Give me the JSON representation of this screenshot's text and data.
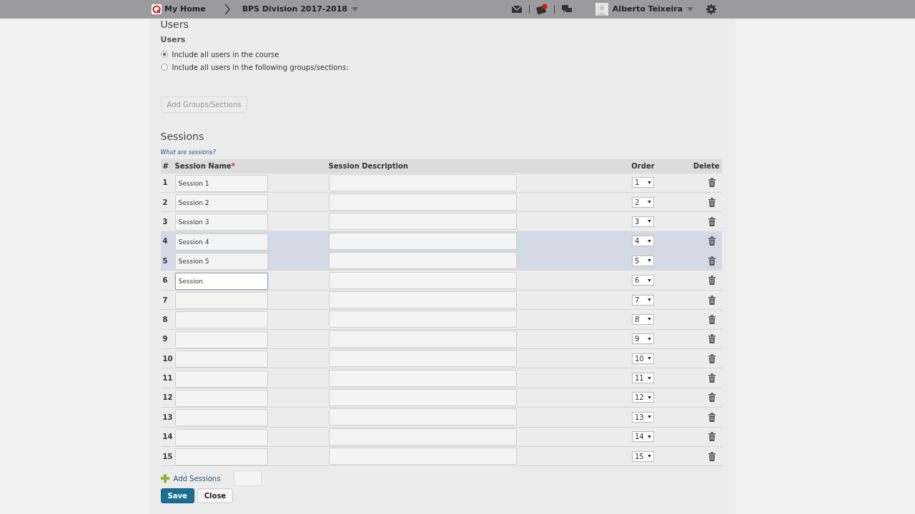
{
  "nav": {
    "home": "My Home",
    "course": "BPS Division 2017-2018",
    "user": "Alberto Teixeira",
    "alert_badge": true
  },
  "users": {
    "title": "Users",
    "label": "Users",
    "options": [
      {
        "label": "Include all users in the course",
        "selected": true
      },
      {
        "label": "Include all users in the following groups/sections:",
        "selected": false
      }
    ],
    "add_button": {
      "label": "Add Groups/Sections",
      "disabled": true
    }
  },
  "sessions": {
    "title": "Sessions",
    "help_link": "What are sessions?",
    "columns": [
      "#",
      "Session Name",
      "Session Description",
      "Order",
      "Delete"
    ],
    "required_mark": "*",
    "rows": [
      {
        "number": "1",
        "name": "Session 1",
        "order": "1",
        "highlighted": false,
        "focused": false
      },
      {
        "number": "2",
        "name": "Session 2",
        "order": "2",
        "highlighted": false,
        "focused": false
      },
      {
        "number": "3",
        "name": "Session 3",
        "order": "3",
        "highlighted": false,
        "focused": false
      },
      {
        "number": "4",
        "name": "Session 4",
        "order": "4",
        "highlighted": true,
        "focused": false
      },
      {
        "number": "5",
        "name": "Session 5",
        "order": "5",
        "highlighted": true,
        "focused": false
      },
      {
        "number": "6",
        "name": "Session",
        "order": "6",
        "highlighted": false,
        "focused": true
      },
      {
        "number": "7",
        "order": "7",
        "highlighted": false,
        "focused": false
      },
      {
        "number": "8",
        "order": "8",
        "highlighted": false,
        "focused": false
      },
      {
        "number": "9",
        "order": "9",
        "highlighted": false,
        "focused": false
      },
      {
        "number": "10",
        "order": "10",
        "highlighted": false,
        "focused": false
      },
      {
        "number": "11",
        "order": "11",
        "highlighted": false,
        "focused": false
      },
      {
        "number": "12",
        "order": "12",
        "highlighted": false,
        "focused": false
      },
      {
        "number": "13",
        "order": "13",
        "highlighted": false,
        "focused": false
      },
      {
        "number": "14",
        "order": "14",
        "highlighted": false,
        "focused": false
      },
      {
        "number": "15",
        "order": "15",
        "highlighted": false,
        "focused": false
      }
    ],
    "add_sessions": "Add Sessions"
  },
  "buttons": [
    {
      "label": "Save",
      "kind": "primary"
    },
    {
      "label": "Close",
      "kind": "secondary"
    }
  ]
}
